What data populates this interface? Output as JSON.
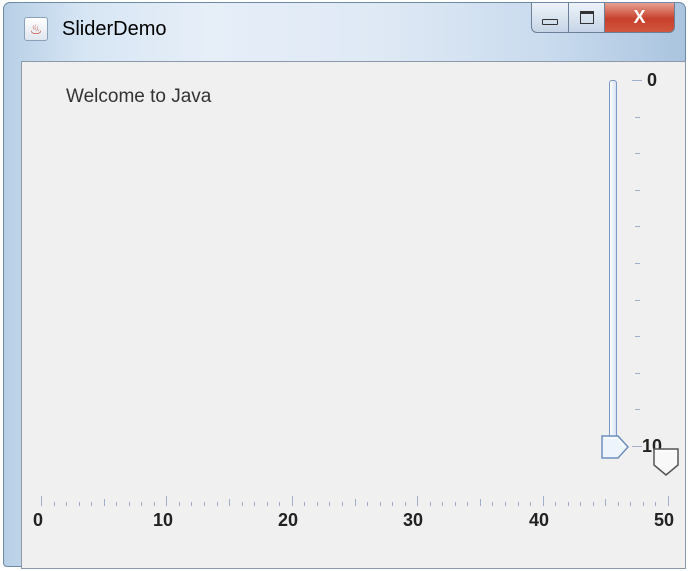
{
  "window": {
    "title": "SliderDemo",
    "minimize_label": "minimize",
    "maximize_label": "maximize",
    "close_label": "X"
  },
  "content": {
    "message": "Welcome to Java"
  },
  "vertical_slider": {
    "min": 0,
    "max": 10,
    "value": 10,
    "labels": [
      "0",
      "10"
    ]
  },
  "horizontal_slider": {
    "min": 0,
    "max": 50,
    "value": 50,
    "labels": [
      "0",
      "10",
      "20",
      "30",
      "40",
      "50"
    ]
  },
  "icons": [
    "java-app-icon",
    "minimize-icon",
    "maximize-icon",
    "close-icon"
  ]
}
